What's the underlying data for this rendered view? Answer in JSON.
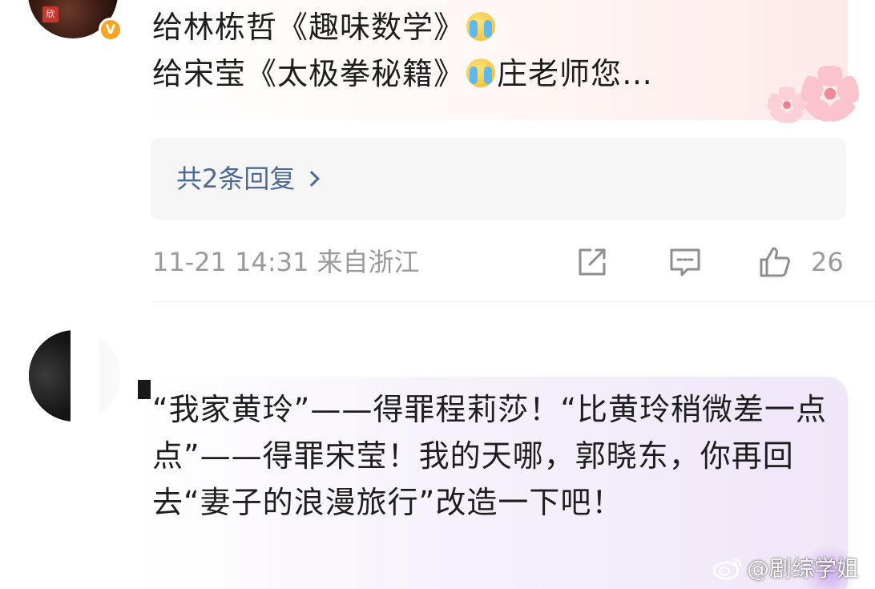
{
  "top_comment": {
    "avatar_seal": "欣",
    "verified_badge": "V",
    "text_part1": "给林栋哲《趣味数学》",
    "text_part2": "给宋莹《太极拳秘籍》",
    "text_part3": "庄老师您…",
    "emoji_icon": "crying-face-icon",
    "decoration_icon": "sakura-flower-icon",
    "replies_label": "共2条回复",
    "timestamp": "11-21 14:31",
    "location": "来自浙江",
    "like_count": "26",
    "icons": {
      "share": "share-icon",
      "comment": "comment-icon",
      "like": "thumbs-up-icon"
    }
  },
  "second_comment": {
    "text": "“我家黄玲”——得罪程莉莎！“比黄玲稍微差一点点”——得罪宋莹！我的天哪，郭晓东，你再回去“妻子的浪漫旅行”改造一下吧！"
  },
  "watermark": {
    "logo_icon": "weibo-logo-icon",
    "text": "@剧综学姐"
  },
  "colors": {
    "link": "#4d6a96",
    "meta": "#9a9a9a",
    "badge": "#f5a623"
  }
}
